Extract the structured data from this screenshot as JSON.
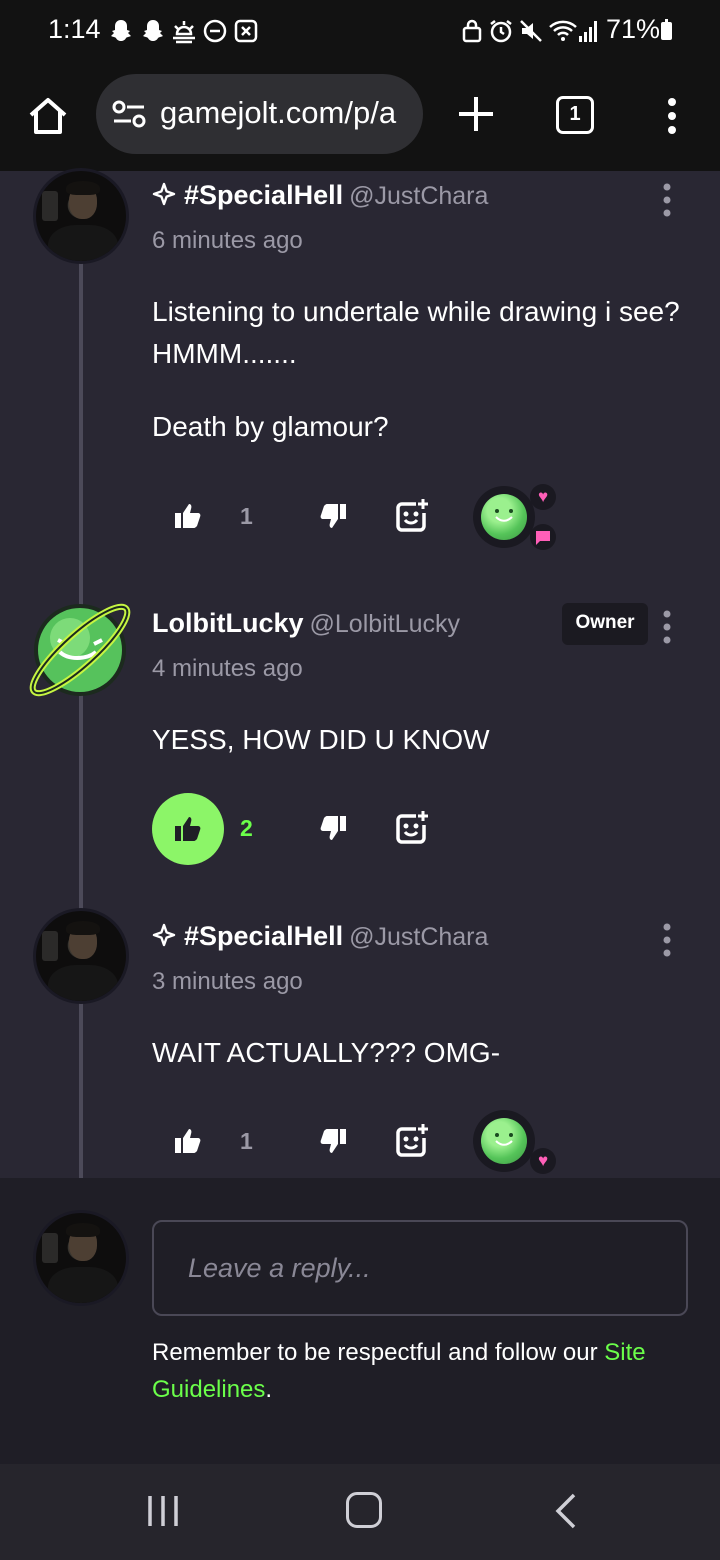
{
  "status_bar": {
    "time": "1:14",
    "battery": "71%",
    "left_icons": [
      "snapchat-icon",
      "snapchat-icon",
      "weather-icon",
      "dnd-icon",
      "notification-x-icon"
    ],
    "right_icons": [
      "lock-icon",
      "alarm-icon",
      "mute-icon",
      "wifi-icon",
      "signal-icon",
      "battery-icon"
    ]
  },
  "browser": {
    "url": "gamejolt.com/p/a",
    "tab_count": "1"
  },
  "comments": [
    {
      "author": "#SpecialHell",
      "handle": "@JustChara",
      "time": "6 minutes ago",
      "body_lines": [
        "Listening to undertale while drawing i see? HMMM.......",
        "Death by glamour?"
      ],
      "likes": "1",
      "liked": false,
      "badge": "",
      "reactions": [
        "slime-reaction"
      ]
    },
    {
      "author": "LolbitLucky",
      "handle": "@LolbitLucky",
      "time": "4 minutes ago",
      "body_lines": [
        "YESS, HOW DID U KNOW"
      ],
      "likes": "2",
      "liked": true,
      "badge": "Owner"
    },
    {
      "author": "#SpecialHell",
      "handle": "@JustChara",
      "time": "3 minutes ago",
      "body_lines": [
        "WAIT ACTUALLY??? OMG-"
      ],
      "likes": "1",
      "liked": false,
      "badge": "",
      "reactions": [
        "slime-reaction"
      ]
    }
  ],
  "reply": {
    "placeholder": "Leave a reply...",
    "note": "Remember to be respectful and follow our ",
    "link": "Site Guidelines",
    "note_end": "."
  },
  "colors": {
    "background": "#292733",
    "accent": "#6bff4a",
    "like_active": "#8cf568",
    "muted_text": "#9b99a6"
  }
}
